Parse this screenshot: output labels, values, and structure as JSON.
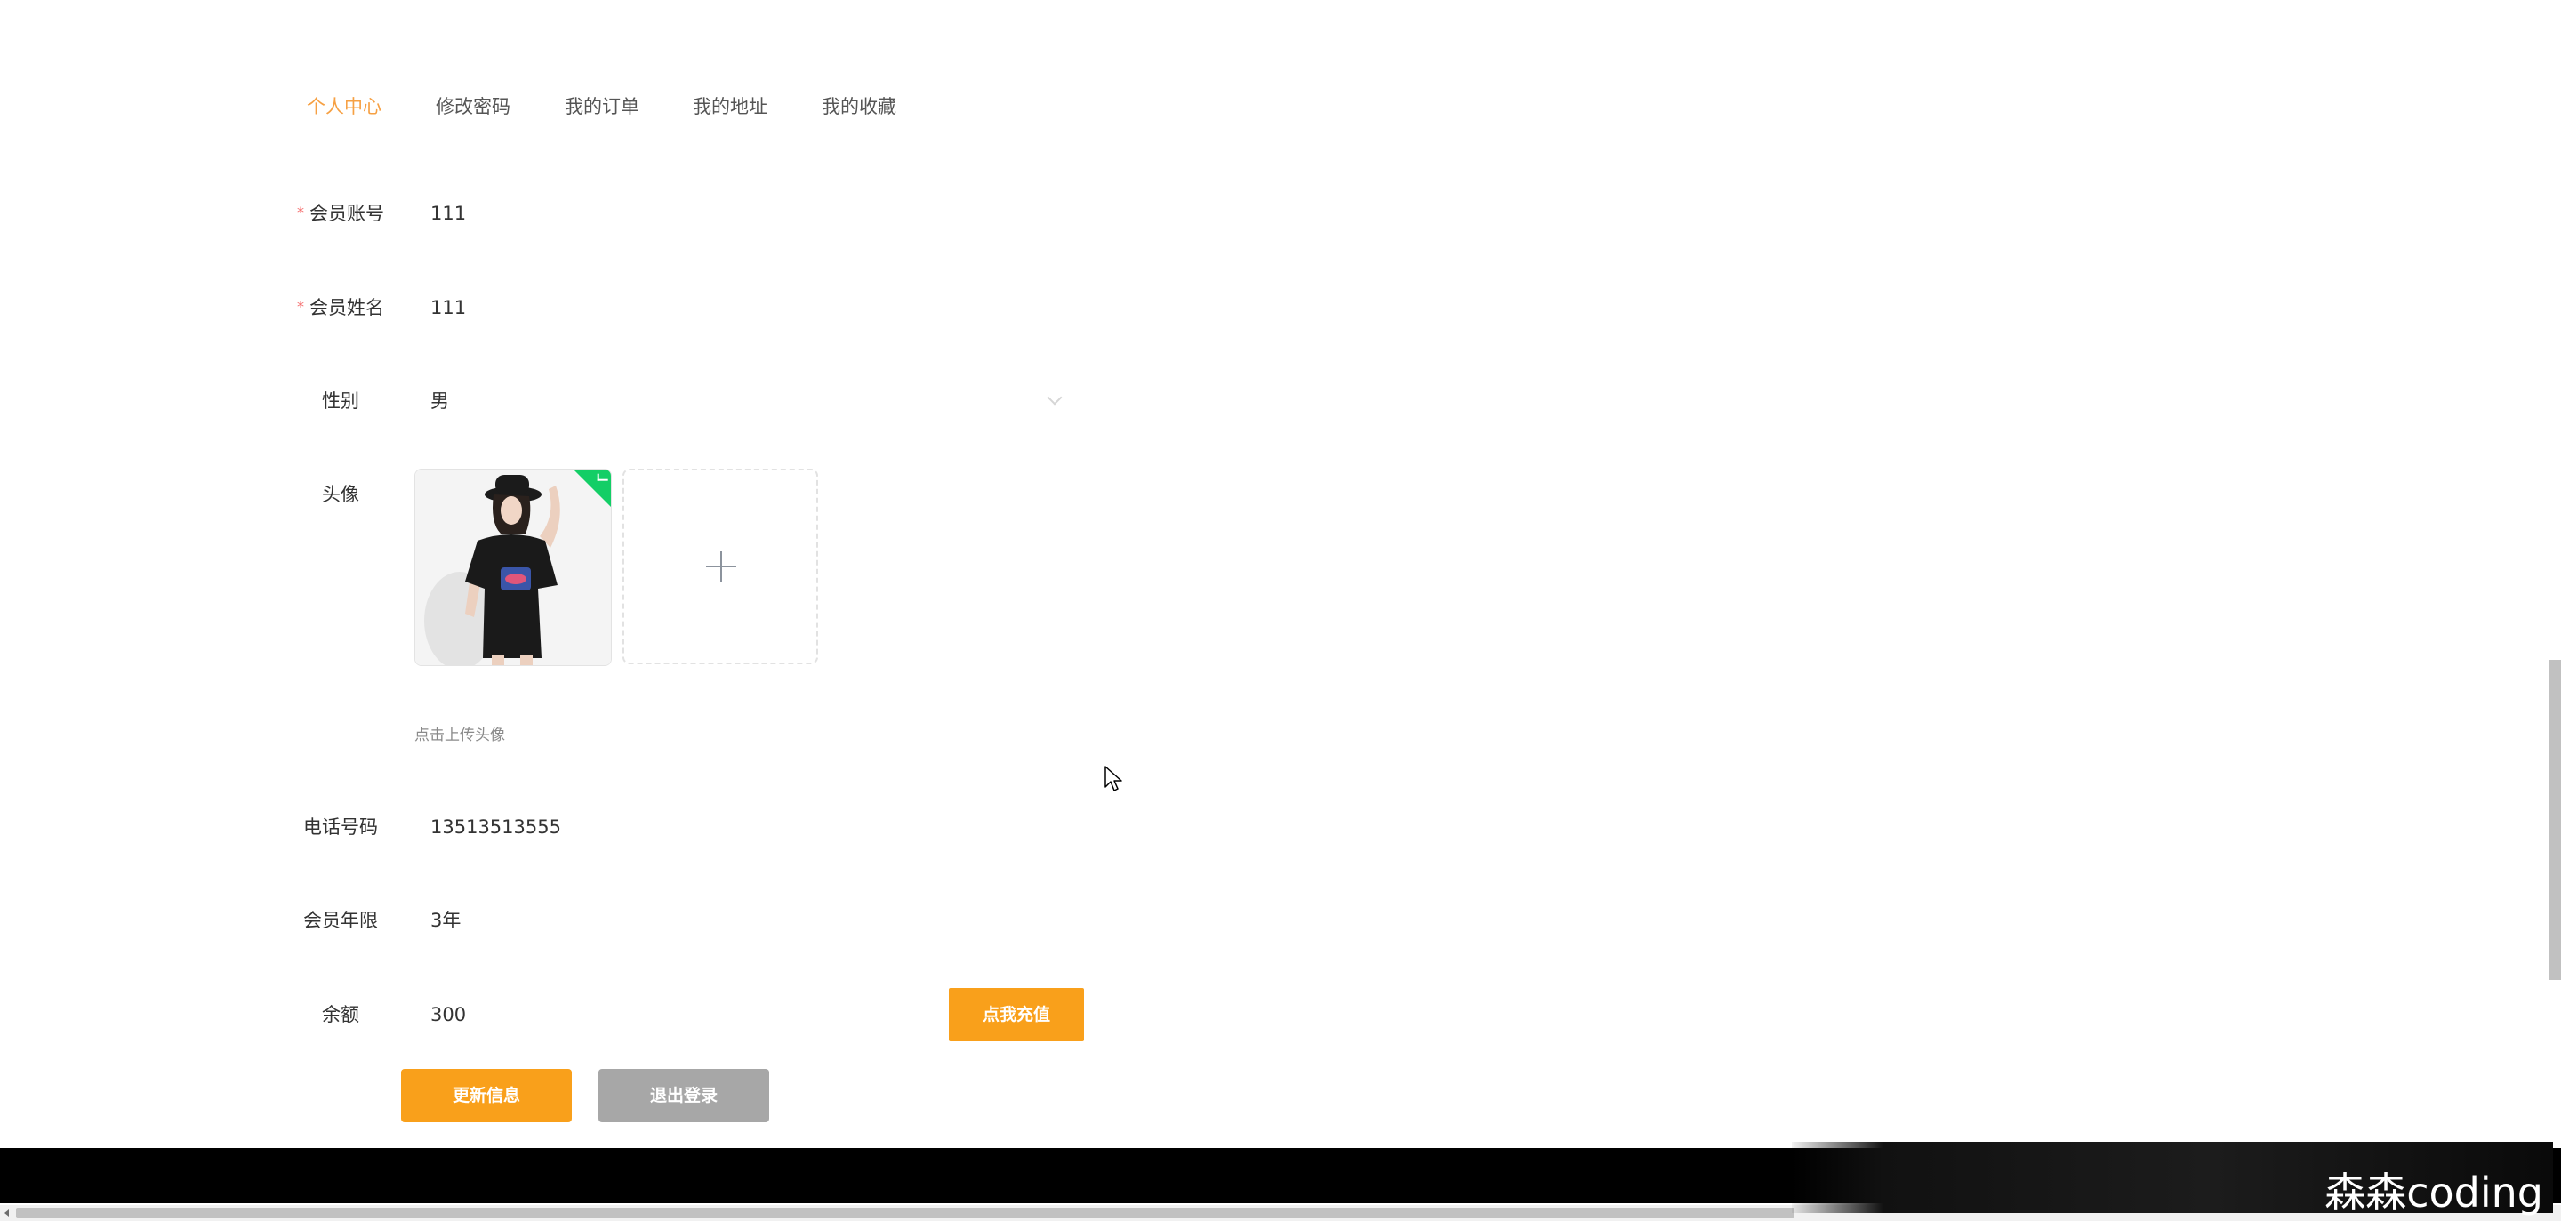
{
  "nav": {
    "tabs": [
      {
        "label": "个人中心",
        "active": true
      },
      {
        "label": "修改密码",
        "active": false
      },
      {
        "label": "我的订单",
        "active": false
      },
      {
        "label": "我的地址",
        "active": false
      },
      {
        "label": "我的收藏",
        "active": false
      }
    ]
  },
  "form": {
    "account": {
      "label": "会员账号",
      "value": "111",
      "required": true
    },
    "name": {
      "label": "会员姓名",
      "value": "111",
      "required": true
    },
    "gender": {
      "label": "性别",
      "value": "男"
    },
    "avatar": {
      "label": "头像",
      "hint": "点击上传头像"
    },
    "phone": {
      "label": "电话号码",
      "value": "13513513555"
    },
    "term": {
      "label": "会员年限",
      "value": "3年"
    },
    "balance": {
      "label": "余额",
      "value": "300"
    }
  },
  "buttons": {
    "recharge": "点我充值",
    "update": "更新信息",
    "logout": "退出登录"
  },
  "watermark": "森森coding",
  "colors": {
    "accent": "#f6a043",
    "button_primary": "#f9a01b",
    "button_secondary": "#a7a7a7",
    "required": "#f56c6c",
    "success": "#13ce66"
  }
}
